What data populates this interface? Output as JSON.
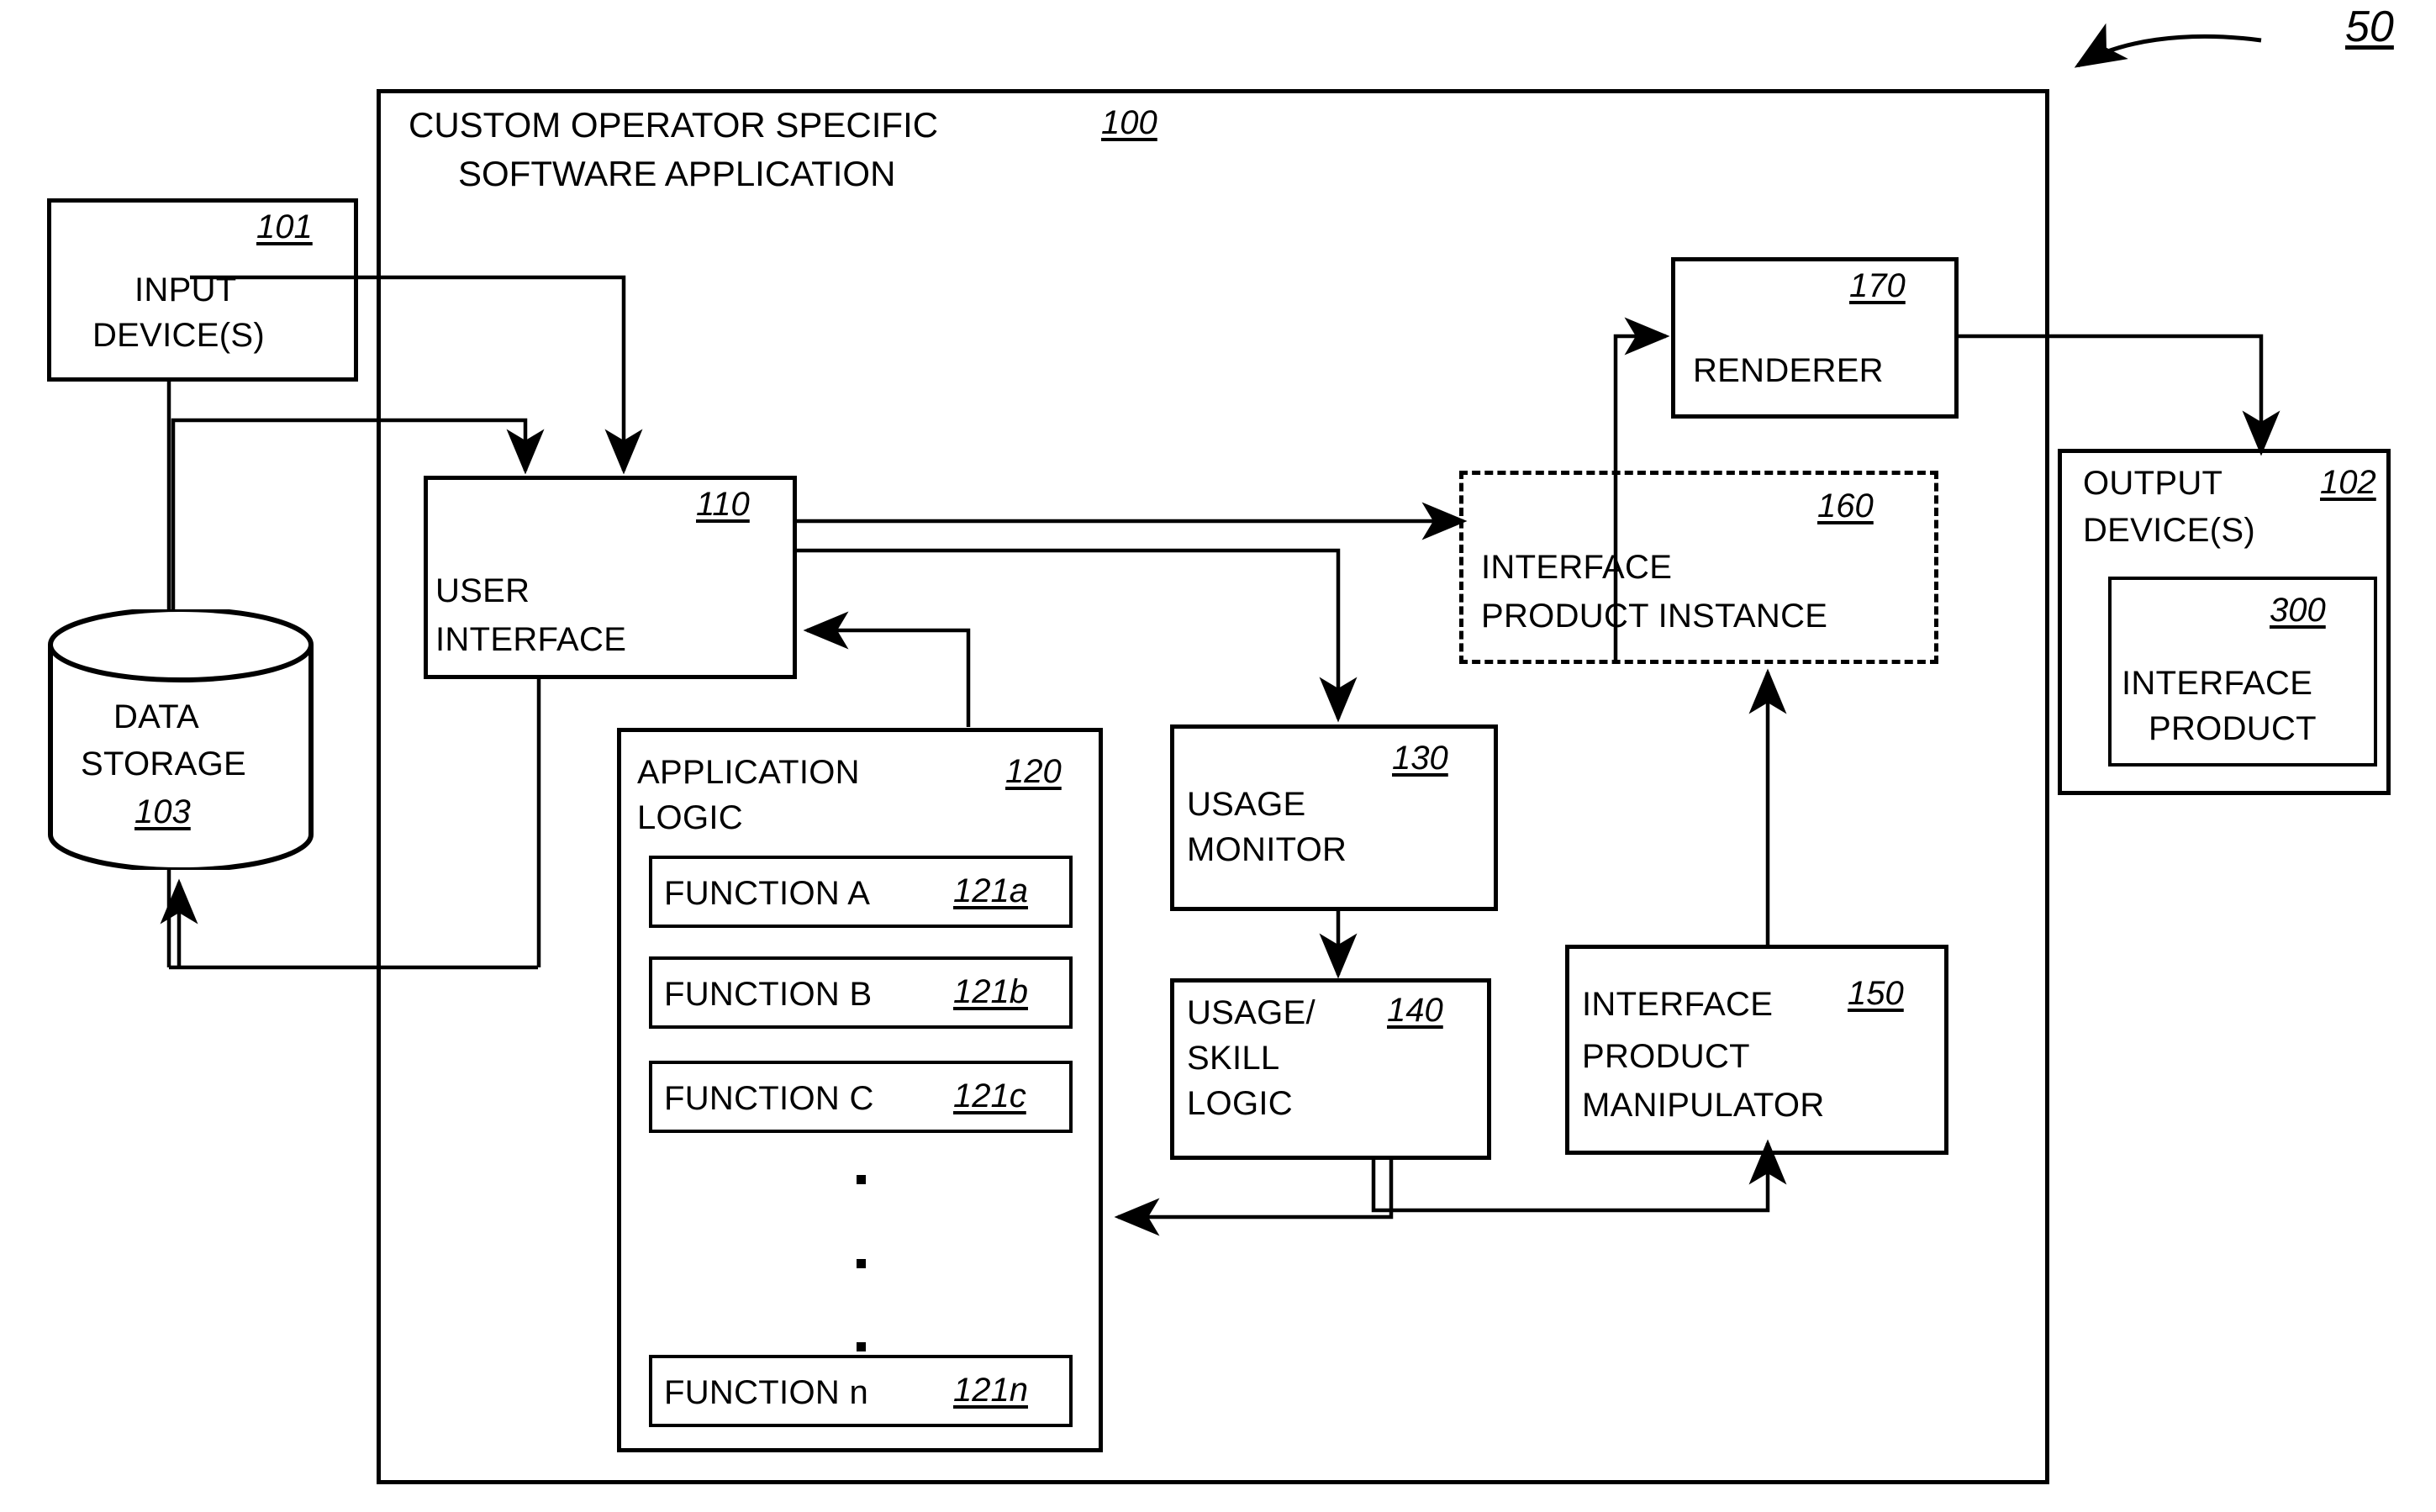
{
  "figure": {
    "number": "50",
    "outer_label": "50"
  },
  "app_container": {
    "title_line1": "CUSTOM OPERATOR SPECIFIC",
    "title_line2": "SOFTWARE APPLICATION",
    "ref": "100"
  },
  "blocks": {
    "input_devices": {
      "line1": "INPUT",
      "line2": "DEVICE(S)",
      "ref": "101"
    },
    "data_storage": {
      "line1": "DATA",
      "line2": "STORAGE",
      "ref": "103"
    },
    "user_interface": {
      "line1": "USER",
      "line2": "INTERFACE",
      "ref": "110"
    },
    "application_logic": {
      "line1": "APPLICATION",
      "line2": "LOGIC",
      "ref": "120"
    },
    "usage_monitor": {
      "line1": "USAGE",
      "line2": "MONITOR",
      "ref": "130"
    },
    "usage_skill_logic": {
      "line1": "USAGE/",
      "line2": "SKILL",
      "line3": "LOGIC",
      "ref": "140"
    },
    "interface_product_manipulator": {
      "line1": "INTERFACE",
      "line2": "PRODUCT",
      "line3": "MANIPULATOR",
      "ref": "150"
    },
    "interface_product_instance": {
      "line1": "INTERFACE",
      "line2": "PRODUCT INSTANCE",
      "ref": "160"
    },
    "renderer": {
      "line1": "RENDERER",
      "ref": "170"
    },
    "output_devices": {
      "line1": "OUTPUT",
      "line2": "DEVICE(S)",
      "ref": "102"
    },
    "interface_product": {
      "line1": "INTERFACE",
      "line2": "PRODUCT",
      "ref": "300"
    }
  },
  "functions": [
    {
      "label": "FUNCTION A",
      "ref": "121a"
    },
    {
      "label": "FUNCTION B",
      "ref": "121b"
    },
    {
      "label": "FUNCTION C",
      "ref": "121c"
    },
    {
      "label": "FUNCTION n",
      "ref": "121n"
    }
  ],
  "ellipsis": "vertical-three-dots",
  "colors": {
    "ink": "#000000",
    "paper": "#ffffff"
  },
  "chart_data": {
    "type": "diagram",
    "title": "Custom operator specific software application block diagram",
    "nodes": [
      {
        "id": "101",
        "label": "INPUT DEVICE(S)"
      },
      {
        "id": "103",
        "label": "DATA STORAGE"
      },
      {
        "id": "100",
        "label": "CUSTOM OPERATOR SPECIFIC SOFTWARE APPLICATION"
      },
      {
        "id": "110",
        "label": "USER INTERFACE"
      },
      {
        "id": "120",
        "label": "APPLICATION LOGIC"
      },
      {
        "id": "121a",
        "label": "FUNCTION A"
      },
      {
        "id": "121b",
        "label": "FUNCTION B"
      },
      {
        "id": "121c",
        "label": "FUNCTION C"
      },
      {
        "id": "121n",
        "label": "FUNCTION n"
      },
      {
        "id": "130",
        "label": "USAGE MONITOR"
      },
      {
        "id": "140",
        "label": "USAGE/ SKILL LOGIC"
      },
      {
        "id": "150",
        "label": "INTERFACE PRODUCT MANIPULATOR"
      },
      {
        "id": "160",
        "label": "INTERFACE PRODUCT INSTANCE"
      },
      {
        "id": "170",
        "label": "RENDERER"
      },
      {
        "id": "102",
        "label": "OUTPUT DEVICE(S)"
      },
      {
        "id": "300",
        "label": "INTERFACE PRODUCT"
      }
    ],
    "edges": [
      {
        "from": "101",
        "to": "110"
      },
      {
        "from": "101",
        "to": "103"
      },
      {
        "from": "103",
        "to": "110"
      },
      {
        "from": "110",
        "to": "103"
      },
      {
        "from": "110",
        "to": "120"
      },
      {
        "from": "110",
        "to": "130"
      },
      {
        "from": "110",
        "to": "160"
      },
      {
        "from": "120",
        "to": "110"
      },
      {
        "from": "130",
        "to": "140"
      },
      {
        "from": "140",
        "to": "120"
      },
      {
        "from": "140",
        "to": "150"
      },
      {
        "from": "150",
        "to": "160"
      },
      {
        "from": "160",
        "to": "170"
      },
      {
        "from": "170",
        "to": "102"
      }
    ]
  }
}
